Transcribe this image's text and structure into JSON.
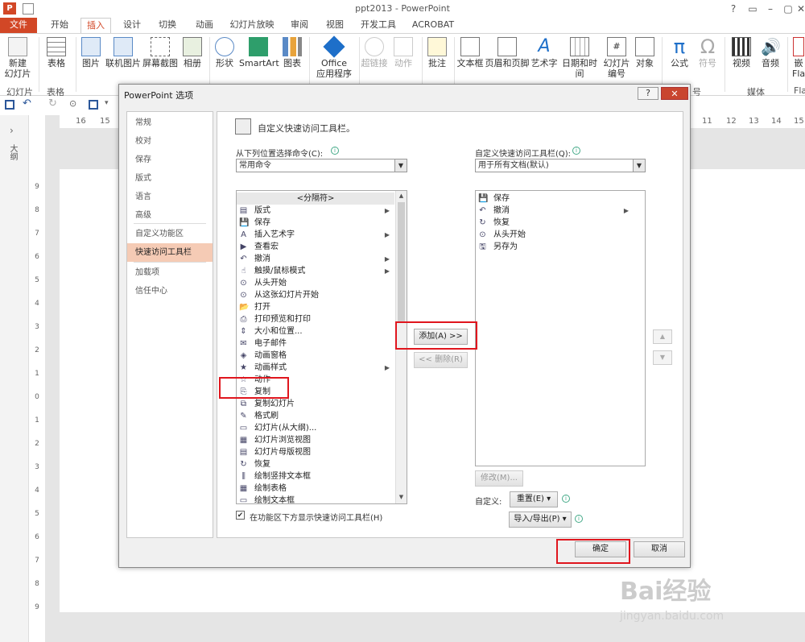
{
  "window": {
    "title": "ppt2013 - PowerPoint",
    "controls": [
      "?",
      "▭",
      "–",
      "▢",
      "✕"
    ]
  },
  "tabs": [
    "文件",
    "开始",
    "插入",
    "设计",
    "切换",
    "动画",
    "幻灯片放映",
    "审阅",
    "视图",
    "开发工具",
    "ACROBAT"
  ],
  "ribbon": {
    "buttons": [
      "新建\n幻灯片",
      "表格",
      "图片",
      "联机图片",
      "屏幕截图",
      "相册",
      "形状",
      "SmartArt",
      "图表",
      "Office\n应用程序",
      "超链接",
      "动作",
      "批注",
      "文本框",
      "页眉和页脚",
      "艺术字",
      "日期和时间",
      "幻灯片\n编号",
      "对象",
      "公式",
      "符号",
      "视频",
      "音频",
      "嵌\nFla"
    ],
    "groups": [
      "幻灯片",
      "表格",
      "号",
      "媒体",
      "Fla"
    ]
  },
  "left_pane": {
    "outline_label": "大纲"
  },
  "rulers": {
    "h_left": [
      "16",
      "15"
    ],
    "h_right": [
      "11",
      "12",
      "13",
      "14",
      "15"
    ],
    "v": [
      "9",
      "8",
      "7",
      "6",
      "5",
      "4",
      "3",
      "2",
      "1",
      "0",
      "1",
      "2",
      "3",
      "4",
      "5",
      "6",
      "7",
      "8",
      "9"
    ]
  },
  "dialog": {
    "title": "PowerPoint 选项",
    "help": "?",
    "close": "✕",
    "nav": [
      "常规",
      "校对",
      "保存",
      "版式",
      "语言",
      "高级",
      "自定义功能区",
      "快速访问工具栏",
      "加载项",
      "信任中心"
    ],
    "selected_nav": "快速访问工具栏",
    "heading": "自定义快速访问工具栏。",
    "choose_label": "从下列位置选择命令(C):",
    "choose_value": "常用命令",
    "customize_label": "自定义快速访问工具栏(Q):",
    "customize_value": "用于所有文档(默认)",
    "commands": [
      {
        "label": "<分隔符>",
        "icon": "",
        "sub": false
      },
      {
        "label": "版式",
        "icon": "▤",
        "sub": true
      },
      {
        "label": "保存",
        "icon": "💾",
        "sub": false
      },
      {
        "label": "插入艺术字",
        "icon": "A",
        "sub": true
      },
      {
        "label": "查看宏",
        "icon": "▶",
        "sub": false
      },
      {
        "label": "撤消",
        "icon": "↶",
        "sub": true
      },
      {
        "label": "触摸/鼠标模式",
        "icon": "☝",
        "sub": true
      },
      {
        "label": "从头开始",
        "icon": "⊙",
        "sub": false
      },
      {
        "label": "从这张幻灯片开始",
        "icon": "⊙",
        "sub": false
      },
      {
        "label": "打开",
        "icon": "📂",
        "sub": false
      },
      {
        "label": "打印预览和打印",
        "icon": "⎙",
        "sub": false
      },
      {
        "label": "大小和位置...",
        "icon": "⇕",
        "sub": false
      },
      {
        "label": "电子邮件",
        "icon": "✉",
        "sub": false
      },
      {
        "label": "动画窗格",
        "icon": "◈",
        "sub": false
      },
      {
        "label": "动画样式",
        "icon": "★",
        "sub": true
      },
      {
        "label": "动作",
        "icon": "☆",
        "sub": false
      },
      {
        "label": "复制",
        "icon": "⎘",
        "sub": false
      },
      {
        "label": "复制幻灯片",
        "icon": "⧉",
        "sub": false
      },
      {
        "label": "格式刷",
        "icon": "✎",
        "sub": false
      },
      {
        "label": "幻灯片(从大纲)...",
        "icon": "▭",
        "sub": false
      },
      {
        "label": "幻灯片浏览视图",
        "icon": "▦",
        "sub": false
      },
      {
        "label": "幻灯片母版视图",
        "icon": "▤",
        "sub": false
      },
      {
        "label": "恢复",
        "icon": "↻",
        "sub": false
      },
      {
        "label": "绘制竖排文本框",
        "icon": "⫼",
        "sub": false
      },
      {
        "label": "绘制表格",
        "icon": "▦",
        "sub": false
      },
      {
        "label": "绘制文本框",
        "icon": "▭",
        "sub": false
      }
    ],
    "toolbar_items": [
      {
        "label": "保存",
        "icon": "💾",
        "sub": false
      },
      {
        "label": "撤消",
        "icon": "↶",
        "sub": true
      },
      {
        "label": "恢复",
        "icon": "↻",
        "sub": false
      },
      {
        "label": "从头开始",
        "icon": "⊙",
        "sub": false
      },
      {
        "label": "另存为",
        "icon": "🖫",
        "sub": false
      }
    ],
    "add_button": "添加(A) >>",
    "remove_button": "<< 删除(R)",
    "modify_button": "修改(M)...",
    "customize_text": "自定义:",
    "reset_button": "重置(E) ▾",
    "import_export_button": "导入/导出(P) ▾",
    "show_below_label": "在功能区下方显示快速访问工具栏(H)",
    "ok_button": "确定",
    "cancel_button": "取消"
  },
  "watermark": {
    "brand": "Bai经验",
    "url": "jingyan.baidu.com"
  },
  "colors": {
    "accent": "#d24726",
    "highlight_box": "#e0161e",
    "nav_selected": "#f5cbb5"
  }
}
